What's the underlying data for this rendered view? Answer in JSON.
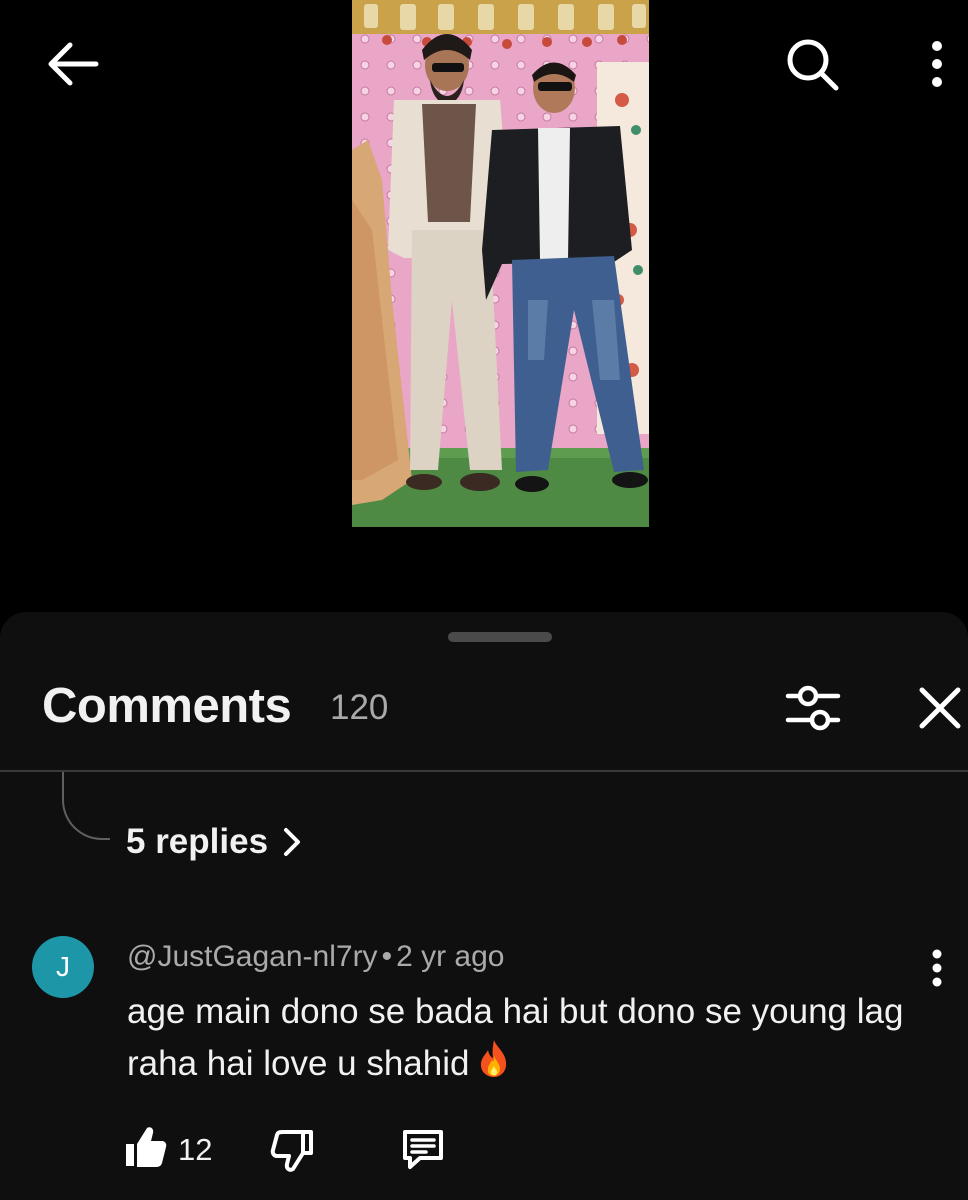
{
  "top_bar": {
    "back_icon": "arrow-left-icon",
    "search_icon": "search-icon",
    "more_icon": "more-vertical-icon"
  },
  "video": {
    "thumbnail": "video-frame"
  },
  "comments_panel": {
    "title": "Comments",
    "count": "120",
    "filter_icon": "sliders-icon",
    "close_icon": "close-icon"
  },
  "thread": {
    "replies_label": "5 replies",
    "chevron_icon": "chevron-right-icon"
  },
  "comment": {
    "avatar_letter": "J",
    "avatar_color": "#1d97a8",
    "author": "@JustGagan-nl7ry",
    "separator": "•",
    "time": "2 yr ago",
    "text": "age main dono se bada hai but dono se young lag raha hai love u shahid",
    "emoji_icon": "fire-emoji-icon",
    "like_count": "12",
    "like_icon": "thumbs-up-filled-icon",
    "dislike_icon": "thumbs-down-icon",
    "reply_icon": "comment-reply-icon"
  },
  "colors": {
    "background": "#000000",
    "sheet": "#0f0f0f",
    "text_primary": "#f1f1f1",
    "text_secondary": "#aaaaaa"
  }
}
